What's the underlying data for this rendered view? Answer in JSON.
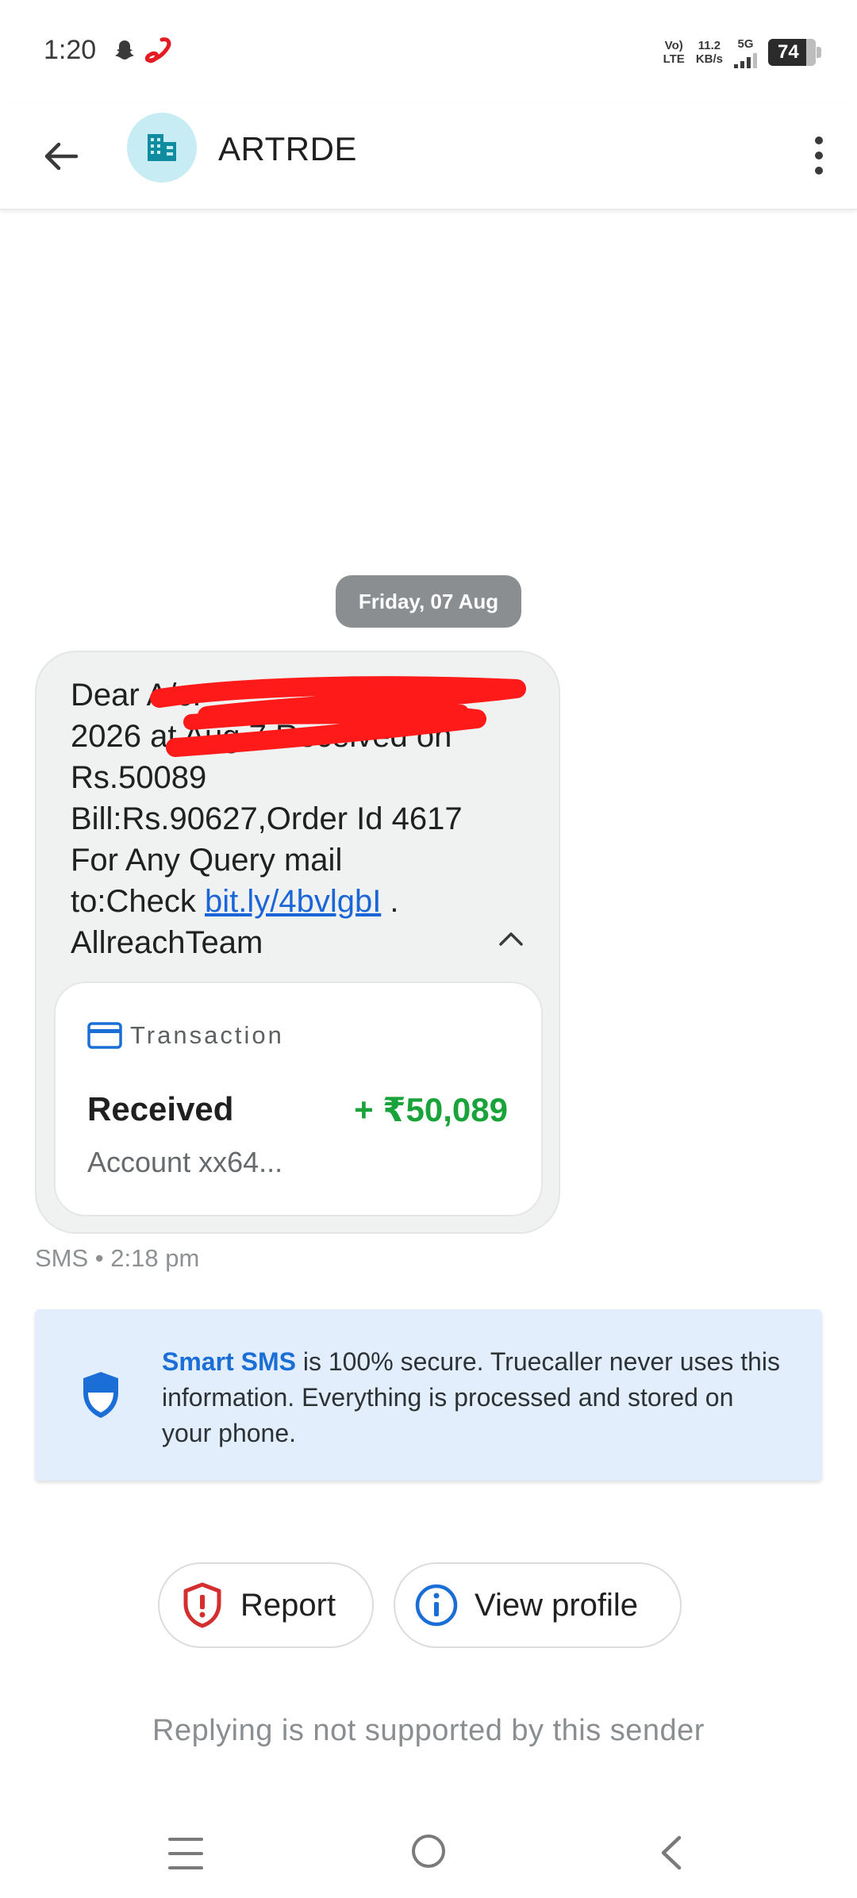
{
  "status_bar": {
    "time": "1:20",
    "volte_top": "Vo)",
    "volte_bottom": "LTE",
    "speed_value": "11.2",
    "speed_unit": "KB/s",
    "network": "5G",
    "battery": "74"
  },
  "header": {
    "sender": "ARTRDE",
    "avatar_icon": "building-icon"
  },
  "conversation": {
    "date_chip": "Friday, 07 Aug",
    "message": {
      "line1": "Dear A/c.",
      "line2": "2026 at Aug 7 Received on",
      "line3": "Rs.50089",
      "line4": "Bill:Rs.90627,Order Id 4617",
      "line5": "For Any Query mail",
      "line6_prefix": "to:Check ",
      "link": "bit.ly/4bvlgbI",
      "line6_suffix": " .",
      "line7": "AllreachTeam"
    },
    "transaction": {
      "title": "Transaction",
      "status": "Received",
      "amount": "+ ₹50,089",
      "account": "Account xx64..."
    },
    "meta": "SMS • 2:18 pm"
  },
  "info_banner": {
    "bold": "Smart SMS",
    "text": " is 100% secure. Truecaller never uses this information. Everything is processed and stored on your phone."
  },
  "actions": {
    "report": "Report",
    "view_profile": "View profile"
  },
  "footer_note": "Replying is not supported by this sender",
  "colors": {
    "accent_blue": "#1a6ed6",
    "amount_green": "#1aa33a",
    "report_red": "#d32f2f",
    "banner_bg": "#e2eefc"
  }
}
